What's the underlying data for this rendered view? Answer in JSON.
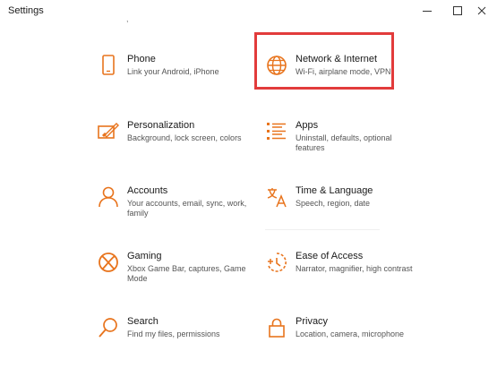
{
  "window": {
    "title": "Settings"
  },
  "colors": {
    "accent": "#e8741d",
    "highlight": "#e23b3b"
  },
  "top_fragment": ",",
  "tiles": [
    {
      "id": "phone",
      "icon": "phone-icon",
      "name": "Phone",
      "desc": "Link your Android, iPhone"
    },
    {
      "id": "network",
      "icon": "globe-icon",
      "name": "Network & Internet",
      "desc": "Wi-Fi, airplane mode, VPN",
      "highlighted": true
    },
    {
      "id": "personalization",
      "icon": "personalization-icon",
      "name": "Personalization",
      "desc": "Background, lock screen, colors"
    },
    {
      "id": "apps",
      "icon": "apps-list-icon",
      "name": "Apps",
      "desc": "Uninstall, defaults, optional features"
    },
    {
      "id": "accounts",
      "icon": "person-icon",
      "name": "Accounts",
      "desc": "Your accounts, email, sync, work, family"
    },
    {
      "id": "time",
      "icon": "time-language-icon",
      "name": "Time & Language",
      "desc": "Speech, region, date"
    },
    {
      "id": "gaming",
      "icon": "xbox-icon",
      "name": "Gaming",
      "desc": "Xbox Game Bar, captures, Game Mode"
    },
    {
      "id": "ease",
      "icon": "ease-of-access-icon",
      "name": "Ease of Access",
      "desc": "Narrator, magnifier, high contrast"
    },
    {
      "id": "search",
      "icon": "search-icon",
      "name": "Search",
      "desc": "Find my files, permissions"
    },
    {
      "id": "privacy",
      "icon": "lock-icon",
      "name": "Privacy",
      "desc": "Location, camera, microphone"
    }
  ]
}
